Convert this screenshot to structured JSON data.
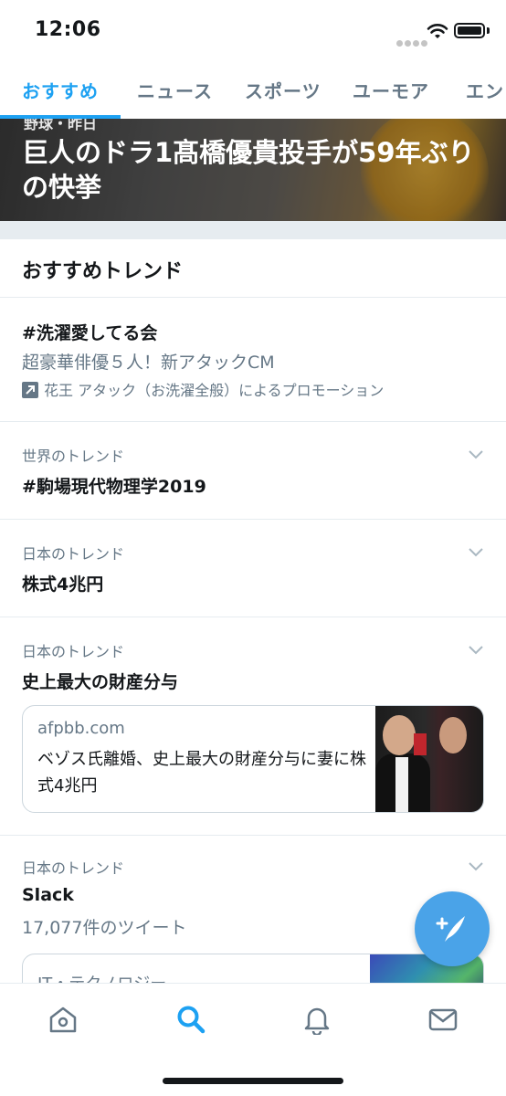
{
  "status_bar": {
    "time": "12:06"
  },
  "tabs": [
    {
      "label": "おすすめ",
      "active": true
    },
    {
      "label": "ニュース",
      "active": false
    },
    {
      "label": "スポーツ",
      "active": false
    },
    {
      "label": "ユーモア",
      "active": false
    },
    {
      "label": "エン",
      "active": false
    }
  ],
  "hero": {
    "category": "野球・昨日",
    "title": "巨人のドラ1髙橋優貴投手が59年ぶりの快挙"
  },
  "section": {
    "title": "おすすめトレンド"
  },
  "trends": [
    {
      "name": "#洗濯愛してる会",
      "description": "超豪華俳優５人！新アタックCM",
      "promotion": "花王 アタック（お洗濯全般）によるプロモーション"
    },
    {
      "context": "世界のトレンド",
      "name": "#駒場現代物理学2019"
    },
    {
      "context": "日本のトレンド",
      "name": "株式4兆円"
    },
    {
      "context": "日本のトレンド",
      "name": "史上最大の財産分与",
      "card": {
        "domain": "afpbb.com",
        "title": "ベゾス氏離婚、史上最大の財産分与に妻に株式4兆円"
      }
    },
    {
      "context": "日本のトレンド",
      "name": "Slack",
      "tweet_count": "17,077件のツイート",
      "card": {
        "category": "IT・テクノロジー"
      }
    }
  ],
  "colors": {
    "accent": "#1da1f2",
    "secondary_text": "#657786",
    "divider": "#e6ecf0"
  },
  "icons": {
    "tabbar": [
      "home-icon",
      "search-icon",
      "notifications-icon",
      "messages-icon"
    ],
    "fab": "compose-tweet-icon"
  }
}
